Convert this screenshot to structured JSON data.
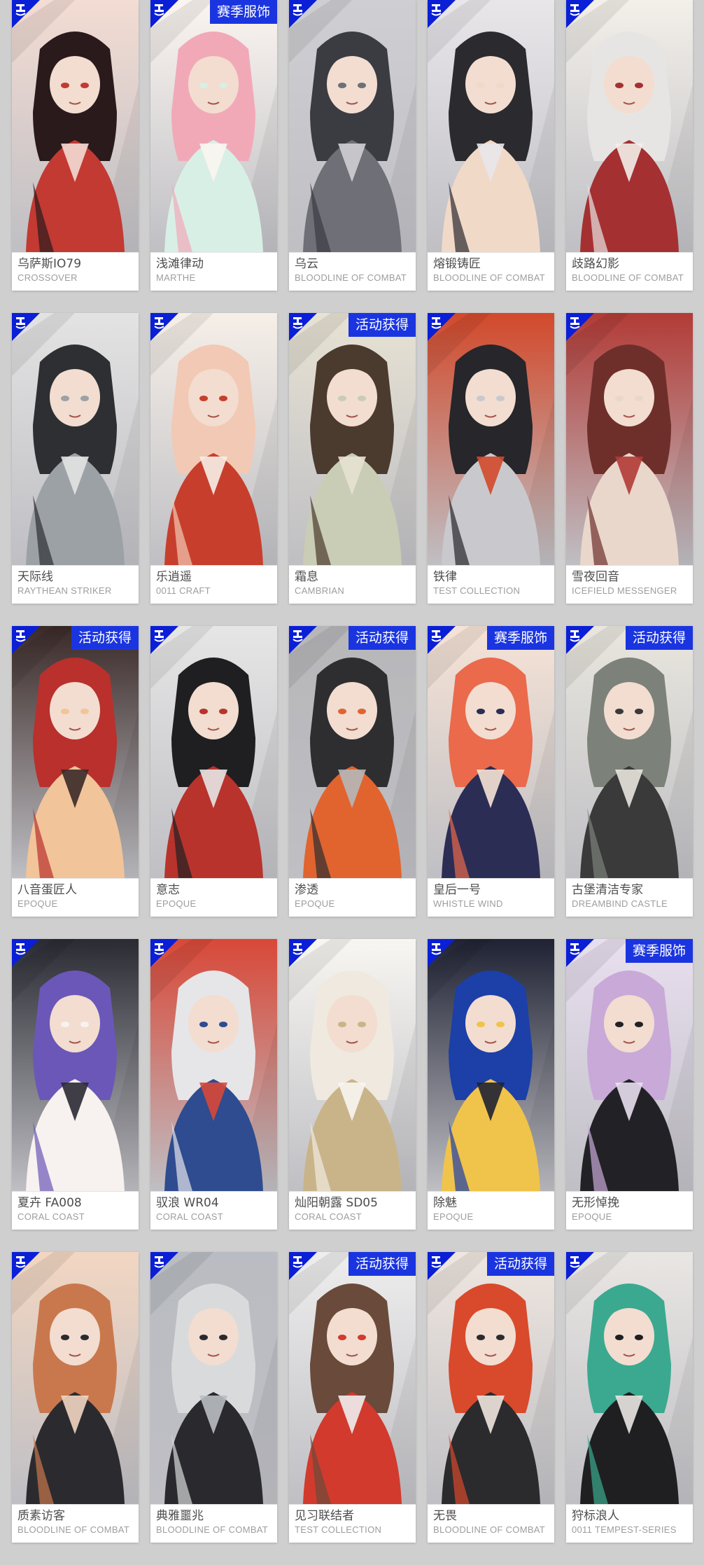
{
  "icons": {
    "brand_mark": "skin-brand-icon"
  },
  "colors": {
    "brand_blue": "#0a1fd6",
    "tag_blue": "#1a35e0",
    "card_bg": "#ffffff",
    "page_bg": "#cfcfcf"
  },
  "cards": [
    {
      "name": "乌萨斯IO79",
      "series": "CROSSOVER",
      "tag": "",
      "palette": [
        "#2a1a1c",
        "#c23a32",
        "#f3dcd3"
      ]
    },
    {
      "name": "浅滩律动",
      "series": "MARTHE",
      "tag": "赛季服饰",
      "palette": [
        "#f1a9b8",
        "#d8efe6",
        "#fbf5f0"
      ]
    },
    {
      "name": "乌云",
      "series": "BLOODLINE OF COMBAT",
      "tag": "",
      "palette": [
        "#3b3b42",
        "#6f6f78",
        "#cfcfd3"
      ]
    },
    {
      "name": "熔锻铸匠",
      "series": "BLOODLINE OF COMBAT",
      "tag": "",
      "palette": [
        "#2b2a2f",
        "#f1d9c8",
        "#e9e6ea"
      ]
    },
    {
      "name": "歧路幻影",
      "series": "BLOODLINE OF COMBAT",
      "tag": "",
      "palette": [
        "#e7e5e4",
        "#a43032",
        "#f3efe9"
      ]
    },
    {
      "name": "天际线",
      "series": "RAYTHEAN STRIKER",
      "tag": "",
      "palette": [
        "#2d2f33",
        "#9ca1a6",
        "#e3e3e3"
      ]
    },
    {
      "name": "乐逍遥",
      "series": "0011 CRAFT",
      "tag": "",
      "palette": [
        "#f2c9b4",
        "#c73f2c",
        "#f6efe8"
      ]
    },
    {
      "name": "霜息",
      "series": "CAMBRIAN",
      "tag": "活动获得",
      "palette": [
        "#4b3b2e",
        "#c9cdb5",
        "#e7e2d3"
      ]
    },
    {
      "name": "铁律",
      "series": "TEST COLLECTION",
      "tag": "",
      "palette": [
        "#26262b",
        "#c9c9cd",
        "#d2492b"
      ]
    },
    {
      "name": "雪夜回音",
      "series": "ICEFIELD MESSENGER",
      "tag": "",
      "palette": [
        "#6e2f2b",
        "#e9d7cc",
        "#b23b36"
      ]
    },
    {
      "name": "八音蛋匠人",
      "series": "EPOQUE",
      "tag": "活动获得",
      "palette": [
        "#b9302d",
        "#f2c49a",
        "#3a2a28"
      ]
    },
    {
      "name": "意志",
      "series": "EPOQUE",
      "tag": "",
      "palette": [
        "#1f1f22",
        "#b8332c",
        "#e6e6e6"
      ]
    },
    {
      "name": "渗透",
      "series": "EPOQUE",
      "tag": "活动获得",
      "palette": [
        "#2e2e31",
        "#e1642f",
        "#b7b7ba"
      ]
    },
    {
      "name": "皇后一号",
      "series": "WHISTLE WIND",
      "tag": "赛季服饰",
      "palette": [
        "#ea6a4b",
        "#2b2d55",
        "#f6e3d6"
      ]
    },
    {
      "name": "古堡清洁专家",
      "series": "DREAMBIND CASTLE",
      "tag": "活动获得",
      "palette": [
        "#7c8279",
        "#3a3a3a",
        "#e9e6de"
      ]
    },
    {
      "name": "夏卉 FA008",
      "series": "CORAL COAST",
      "tag": "",
      "palette": [
        "#6b57b8",
        "#f7f2ef",
        "#2a2a33"
      ]
    },
    {
      "name": "驭浪 WR04",
      "series": "CORAL COAST",
      "tag": "",
      "palette": [
        "#e6e6e9",
        "#2e4c8f",
        "#d84838"
      ]
    },
    {
      "name": "灿阳朝露 SD05",
      "series": "CORAL COAST",
      "tag": "",
      "palette": [
        "#efe9df",
        "#c9b48a",
        "#f8f6f2"
      ]
    },
    {
      "name": "除魅",
      "series": "EPOQUE",
      "tag": "",
      "palette": [
        "#1c3fa8",
        "#f0c34a",
        "#1f2233"
      ]
    },
    {
      "name": "无形悼挽",
      "series": "EPOQUE",
      "tag": "赛季服饰",
      "palette": [
        "#c8a9d8",
        "#222226",
        "#e9dff0"
      ]
    },
    {
      "name": "质素访客",
      "series": "BLOODLINE OF COMBAT",
      "tag": "",
      "palette": [
        "#c9784d",
        "#2b2b2f",
        "#f2d6c2"
      ]
    },
    {
      "name": "典雅噩兆",
      "series": "BLOODLINE OF COMBAT",
      "tag": "",
      "palette": [
        "#d9dadc",
        "#2a2a2e",
        "#b9bcc2"
      ]
    },
    {
      "name": "见习联结者",
      "series": "TEST COLLECTION",
      "tag": "活动获得",
      "palette": [
        "#6a4a3a",
        "#d23a2e",
        "#eeeeee"
      ]
    },
    {
      "name": "无畏",
      "series": "BLOODLINE OF COMBAT",
      "tag": "活动获得",
      "palette": [
        "#d9492c",
        "#2b2b2e",
        "#efe6df"
      ]
    },
    {
      "name": "狩标浪人",
      "series": "0011 TEMPEST-SERIES",
      "tag": "",
      "palette": [
        "#3ba98f",
        "#1f1f22",
        "#e9e6e3"
      ]
    }
  ]
}
